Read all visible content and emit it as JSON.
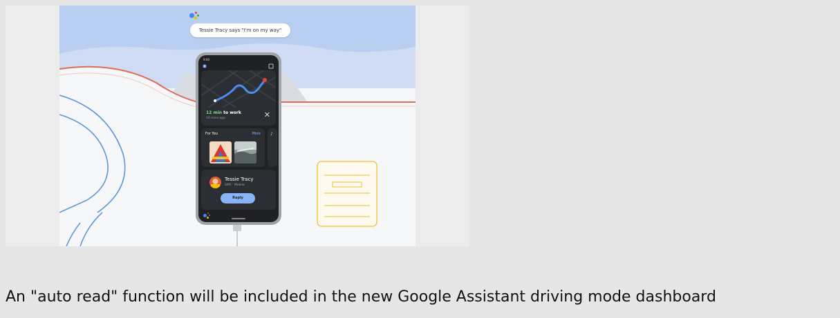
{
  "illustration": {
    "assistant_message": "Tessie Tracy says \"I'm on my way\"",
    "phone": {
      "status_time": "9:00",
      "eta_minutes": "12 min",
      "eta_suffix": " to work",
      "eta_updated": "10 mins ago",
      "for_you_label": "For You",
      "more_label": "More",
      "contact_name": "Tessie Tracy",
      "contact_detail": "SMS · Mobile",
      "reply_label": "Reply"
    }
  },
  "caption": "An \"auto read\" function will be included in the new Google Assistant driving mode dashboard",
  "colors": {
    "sky": "#b9cff1",
    "dash_line": "#e26a57",
    "wheel_line": "#5f97db",
    "notepad": "#efc94c",
    "reply_button": "#8ab4f8",
    "eta_green": "#7fdc8c"
  }
}
